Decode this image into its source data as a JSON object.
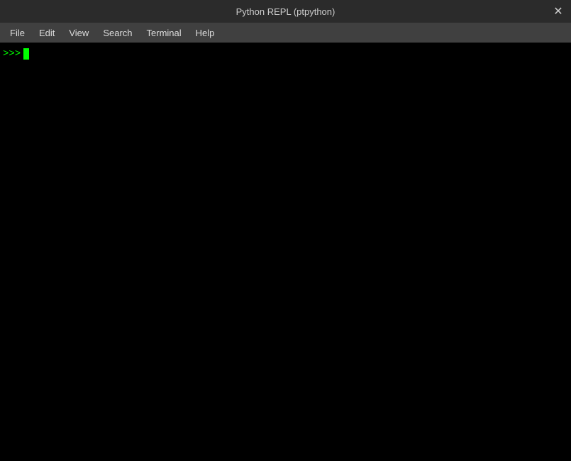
{
  "titlebar": {
    "title": "Python REPL (ptpython)",
    "close_button": "✕"
  },
  "menubar": {
    "items": [
      {
        "label": "File"
      },
      {
        "label": "Edit"
      },
      {
        "label": "View"
      },
      {
        "label": "Search"
      },
      {
        "label": "Terminal"
      },
      {
        "label": "Help"
      }
    ]
  },
  "terminal": {
    "prompt": ">>>"
  }
}
